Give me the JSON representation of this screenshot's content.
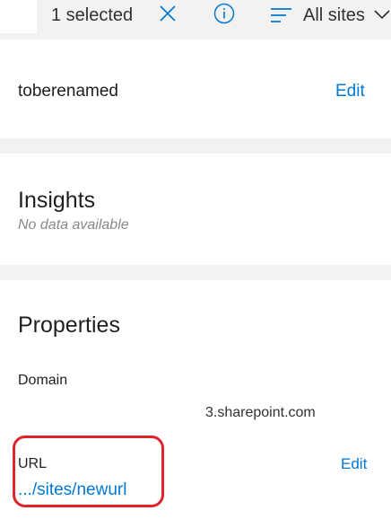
{
  "command_bar": {
    "selected_count_label": "1 selected",
    "close_icon": "close-icon",
    "info_icon": "info-icon",
    "view_icon": "filter-lines-icon",
    "view_label": "All sites",
    "view_chevron_icon": "chevron-down-icon"
  },
  "site": {
    "name": "toberenamed",
    "edit_label": "Edit"
  },
  "insights": {
    "heading": "Insights",
    "empty_text": "No data available"
  },
  "properties": {
    "heading": "Properties",
    "domain_label": "Domain",
    "domain_value": "3.sharepoint.com",
    "url_label": "URL",
    "url_value": ".../sites/newurl",
    "url_edit_label": "Edit"
  },
  "colors": {
    "accent": "#0078d4",
    "separator": "#f3f2f1",
    "annotation": "#e0242b"
  }
}
